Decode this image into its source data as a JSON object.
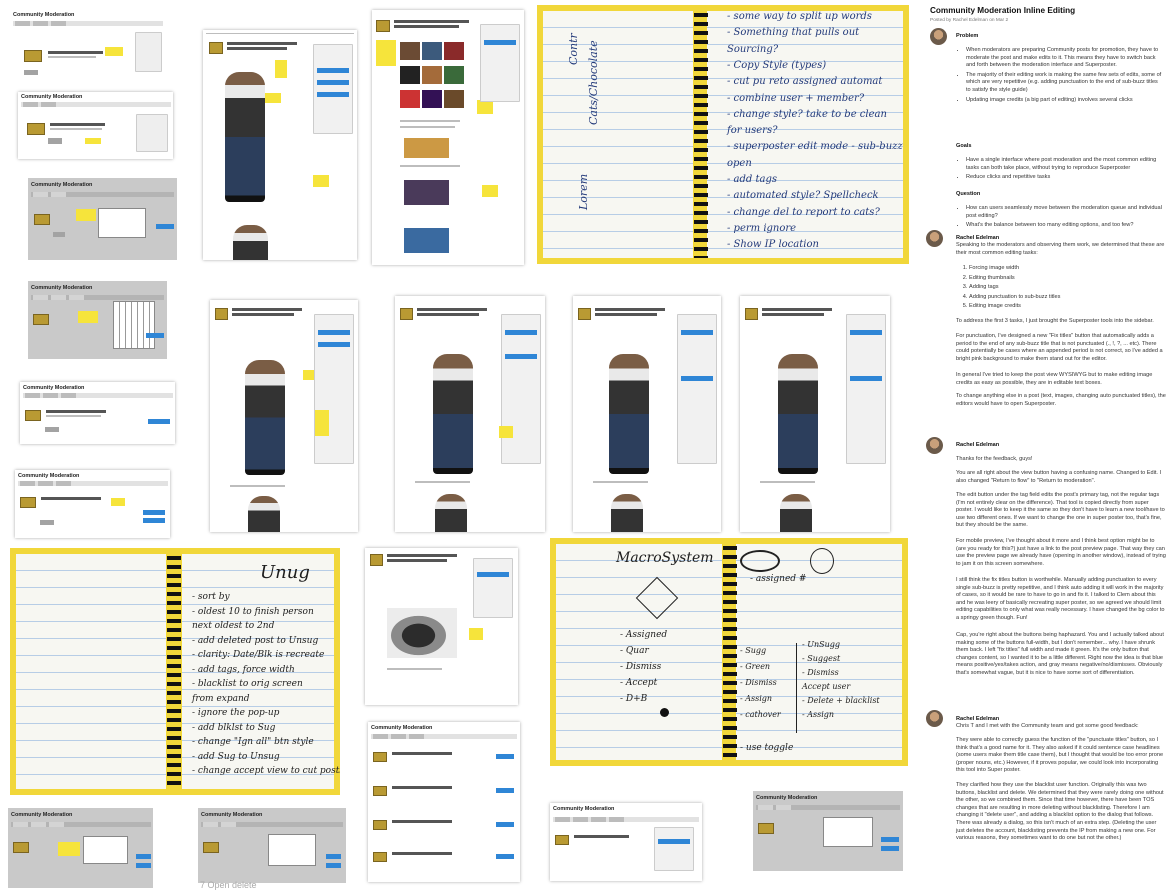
{
  "article": {
    "title": "Community Moderation Inline Editing",
    "meta": "Posted by Rachel Edelman on Mar 2",
    "problem_heading": "Problem",
    "problem_items": [
      "When moderators are preparing Community posts for promotion, they have to moderate the post and make edits to it. This means they have to switch back and forth between the moderation interface and Superposter.",
      "The majority of their editing work is making the same few sets of edits, some of which are very repetitive (e.g. adding punctuation to the end of sub-buzz titles to satisfy the style guide)",
      "Updating image credits (a big part of editing) involves several clicks"
    ],
    "goals_heading": "Goals",
    "goals_items": [
      "Have a single interface where post moderation and the most common editing tasks can both take place, without trying to reproduce Superposter",
      "Reduce clicks and repetitive tasks"
    ],
    "question_heading": "Question",
    "question_items": [
      "How can users seamlessly move between the moderation queue and individual post editing?",
      "What's the balance between too many editing options, and too few?"
    ]
  },
  "comments": [
    {
      "author": "Rachel Edelman",
      "intro": "Speaking to the moderators and observing them work, we determined that these are their most common editing tasks:",
      "tasks": [
        "Forcing image width",
        "Editing thumbnails",
        "Adding tags",
        "Adding punctuation to sub-buzz titles",
        "Editing image credits"
      ],
      "p1": "To address the first 3 tasks, I just brought the Superposter tools into the sidebar.",
      "p2_bold": "punctuation",
      "p2": "For punctuation, I've designed a new \"Fix titles\" button that automatically adds a period to the end of any sub-buzz title that is not punctuated (., !, ?, ... etc). There could potentially be cases where an appended period is not correct, so I've added a bright pink background to make them stand out for the editor.",
      "p3": "In general I've tried to keep the post view WYSIWYG but to make editing image credits as easy as possible, they are in editable text boxes.",
      "p4": "To change anything else in a post (text, images, changing auto punctuated titles), the editors would have to open Superposter."
    },
    {
      "author": "Rachel Edelman",
      "p0": "Thanks for the feedback, guys!",
      "p1": "You are all right about the view button having a confusing name. Changed to Edit. I also changed \"Return to flow\" to \"Return to moderation\".",
      "p2": "The edit button under the tag field edits the post's primary tag, not the regular tags (I'm not entirely clear on the difference). That tool is copied directly from super poster. I would like to keep it the same so they don't have to learn a new tool/have to use two different ones. If we want to change the one in super poster too, that's fine, but they should be the same.",
      "p3": "For mobile preview, I've thought about it more and I think best option might be to (are you ready for this?) just have a link to the post preview page. That way they can use the preview page we already have (opening in another window), instead of trying to jam it on this screen somewhere.",
      "p4": "I still think the fix titles button is worthwhile. Manually adding punctuation to every single sub-buzz is pretty repetitive, and I think auto adding it will work in the majority of cases, so it would be rare to have to go in and fix it. I talked to Clem about this and he was leery of basically recreating super poster, so we agreed we should limit editing capabilities to only what was really necessary. I have changed the bg color to a springy green though. Fun!",
      "p5": "Cap, you're right about the buttons being haphazard. You and I actually talked about making some of the buttons full-width, but I don't remember... why. I have shrunk them back. I left \"fix titles\" full width and made it green. It's the only button that changes content, so I wanted it to be a little different. Right now the idea is that blue means positive/yes/takes action, and gray means negative/no/dismisses. Obviously that's somewhat vague, but it is nice to have some sort of differentiation."
    },
    {
      "author": "Rachel Edelman",
      "p0": "Chris T and I met with the Community team and got some good feedback:",
      "p1": "They were able to correctly guess the function of the \"punctuate titles\" button, so I think that's a good name for it. They also asked if it could sentence case headlines (some users make them title case them), but I thought that would be too error prone (proper nouns, etc.) However, if it proves popular, we could look into incorporating this tool into Super poster.",
      "p2": "They clarified how they use the blacklist user function. Originally this was two buttons, blacklist and delete. We determined that they were rarely doing one without the other, so we combined them. Since that time however, there have been TOS changes that are resulting in more deleting without blacklisting. Therefore I am changing it \"delete user\", and adding a blacklist option to the dialog that follows. There was already a dialog, so this isn't much of an extra step. (Deleting the user just deletes the account, blacklisting prevents the IP from making a new one. For various reasons, they sometimes want to do one but not the other.)"
    }
  ],
  "wireframes": {
    "app_title": "Community Moderation",
    "caption_bottom": "7 Open delete"
  },
  "notebook_top": {
    "side_note_1": "Contr",
    "side_note_2": "Cats/Chocolate",
    "side_note_3": "Lorem",
    "lines": [
      "- some way to split up words",
      "- Something that pulls out",
      "  Sourcing?",
      "- Copy Style (types)",
      "- cut pu reto assigned automat",
      "- combine user + member?",
      "- change style? take to be clean",
      "  for users?",
      "- superposter edit mode - sub-buzz",
      "  open",
      "- add tags",
      "- automated style? Spellcheck",
      "- change del to report to cats?",
      "- perm ignore",
      "- Show IP location"
    ]
  },
  "notebook_bottom": {
    "heading": "Unug",
    "lines": [
      "- sort by",
      "  - oldest 10 to finish person",
      "    next oldest to 2nd",
      "- add deleted post to Unsug",
      "- clarity: Date/Blk is recreate",
      "- add tags, force width",
      "  - blacklist to orig screen",
      "    from expand",
      "  - ignore the pop-up",
      "- add blklst to Sug",
      "- change \"Ign all\" btn style",
      "- add Sug to Unsug",
      "- change accept view to cut posts"
    ]
  },
  "notebook_sketch": {
    "title": "MacroSystem",
    "left_list": [
      "- Assigned",
      "- Quar",
      "- Dismiss",
      "- Accept",
      "- D+B"
    ],
    "mid_a": [
      "- Sugg",
      "- Green",
      "- Dismiss",
      "- Assign",
      "- cathover"
    ],
    "mid_b": [
      "- UnSugg",
      "- Suggest",
      "- Dismiss",
      "Accept user",
      "- Delete + blacklist",
      "- Assign"
    ],
    "top_note": "- assigned #",
    "footer": "- use toggle"
  },
  "colors": {
    "sticky": "#f6e43b",
    "action_blue": "#2f86d6",
    "dismiss_gray": "#a3a3a3",
    "notebook_frame": "#f1d73a"
  }
}
